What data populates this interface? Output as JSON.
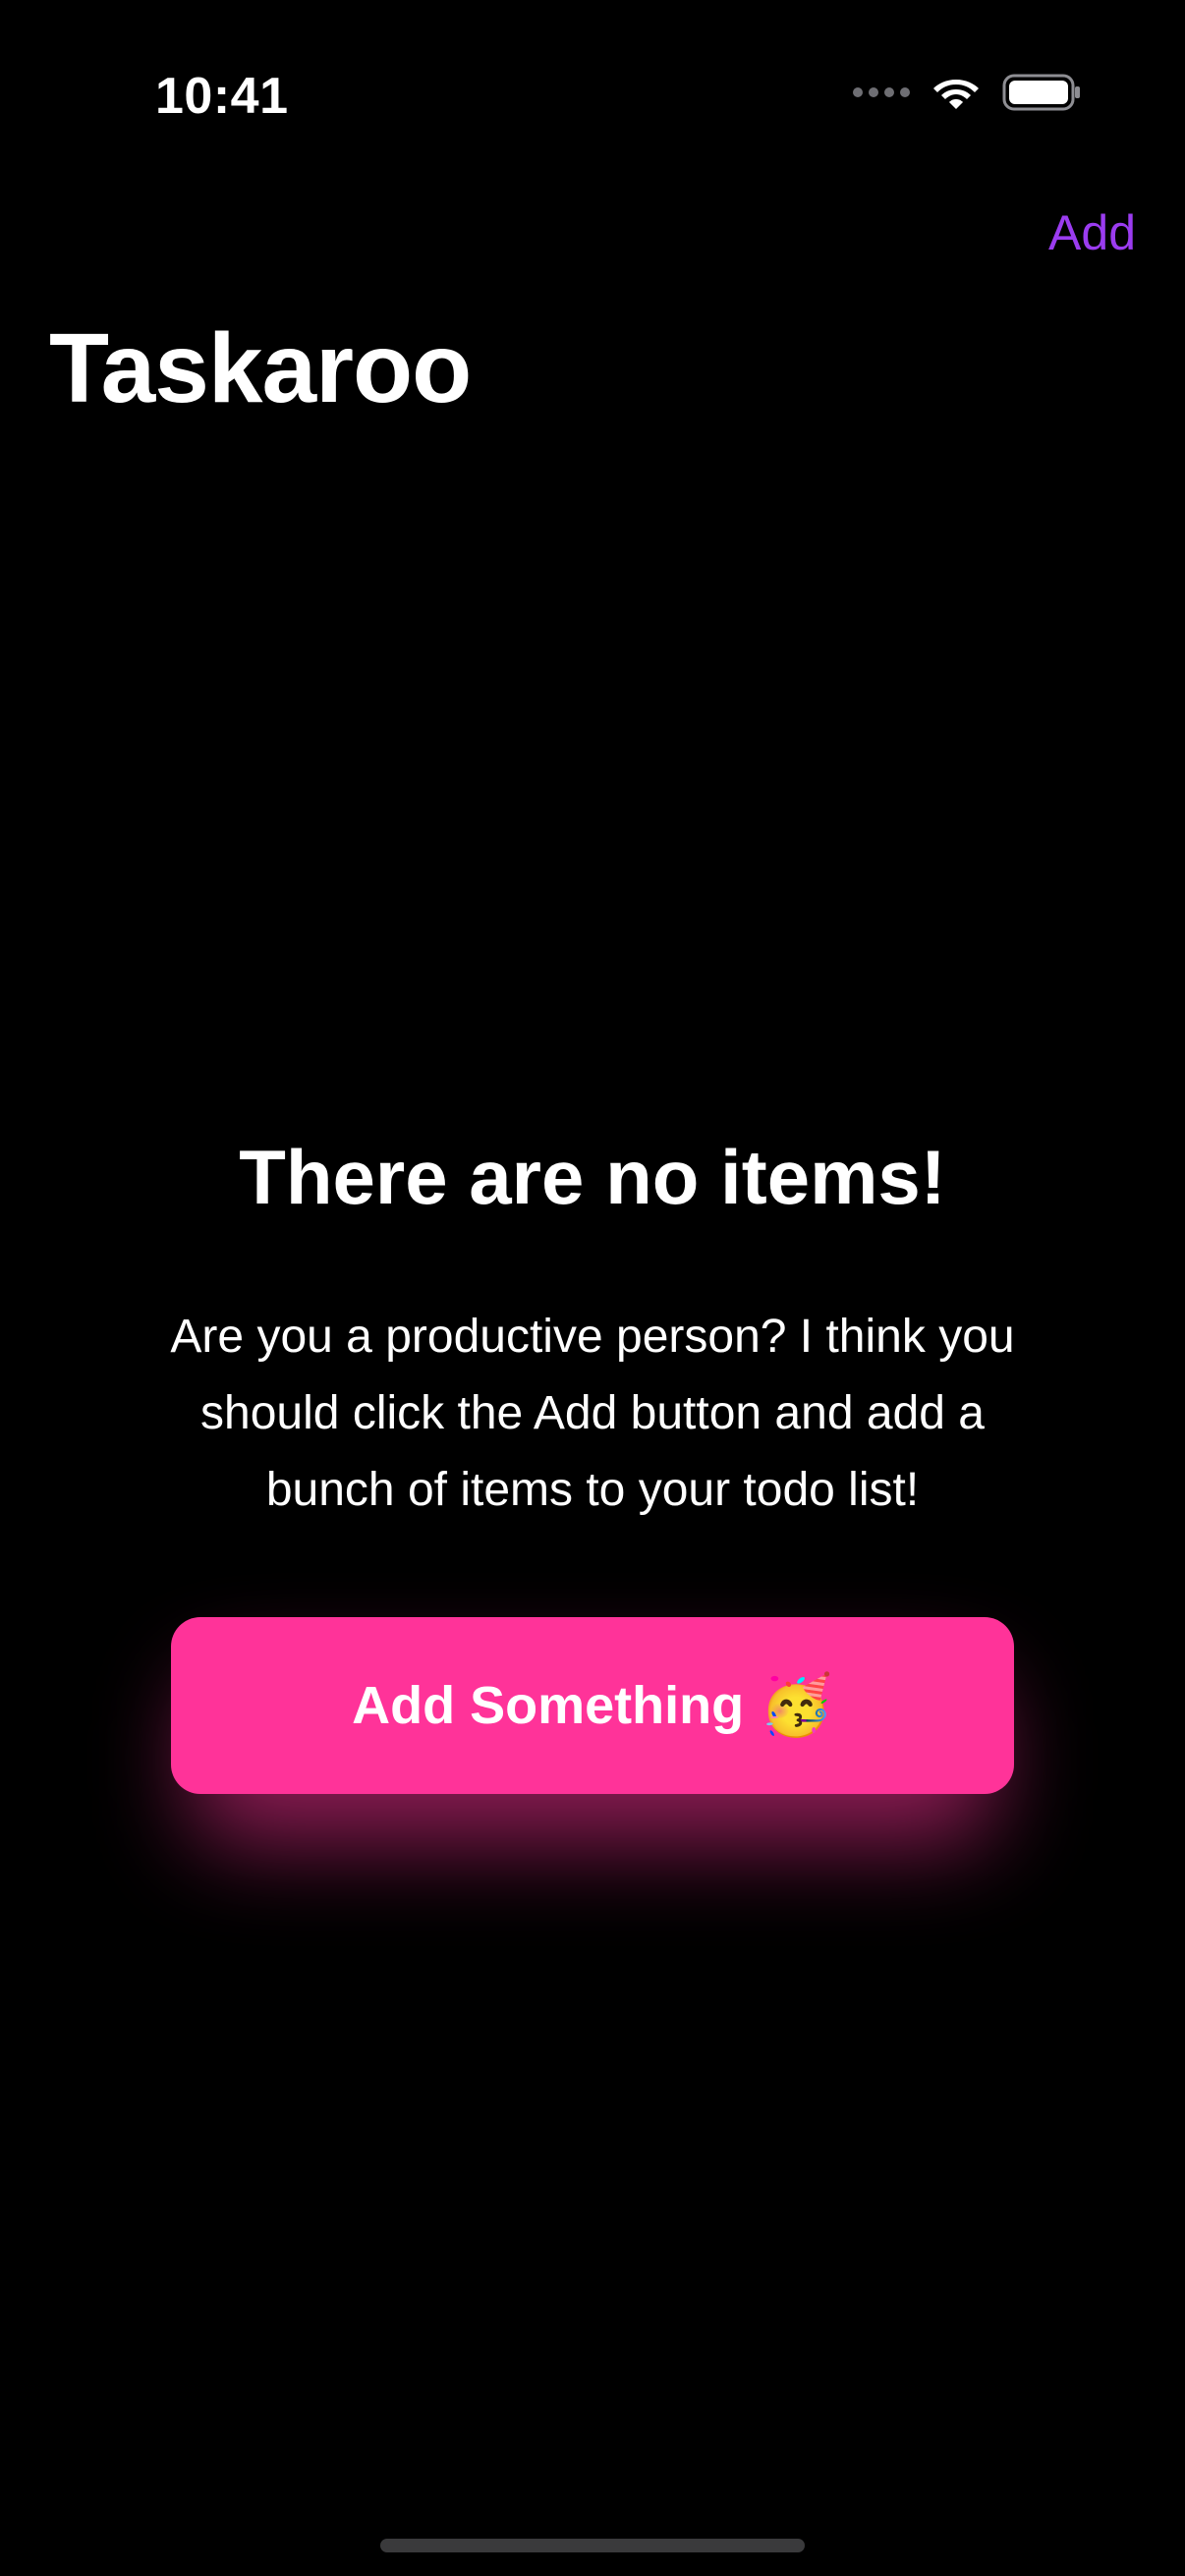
{
  "status_bar": {
    "time": "10:41",
    "wifi_icon": "wifi-icon",
    "battery_icon": "battery-icon",
    "signal_icon": "cellular-signal-icon"
  },
  "nav": {
    "add_label": "Add",
    "title": "Taskaroo"
  },
  "empty_state": {
    "heading": "There are no items!",
    "body": "Are you a productive person? I think you should click the Add button and add a bunch of items to your todo list!",
    "cta_label": "Add Something",
    "cta_emoji": "🥳"
  },
  "colors": {
    "background": "#000000",
    "accent": "#9b3cf0",
    "cta": "#ff3399",
    "text": "#ffffff"
  }
}
